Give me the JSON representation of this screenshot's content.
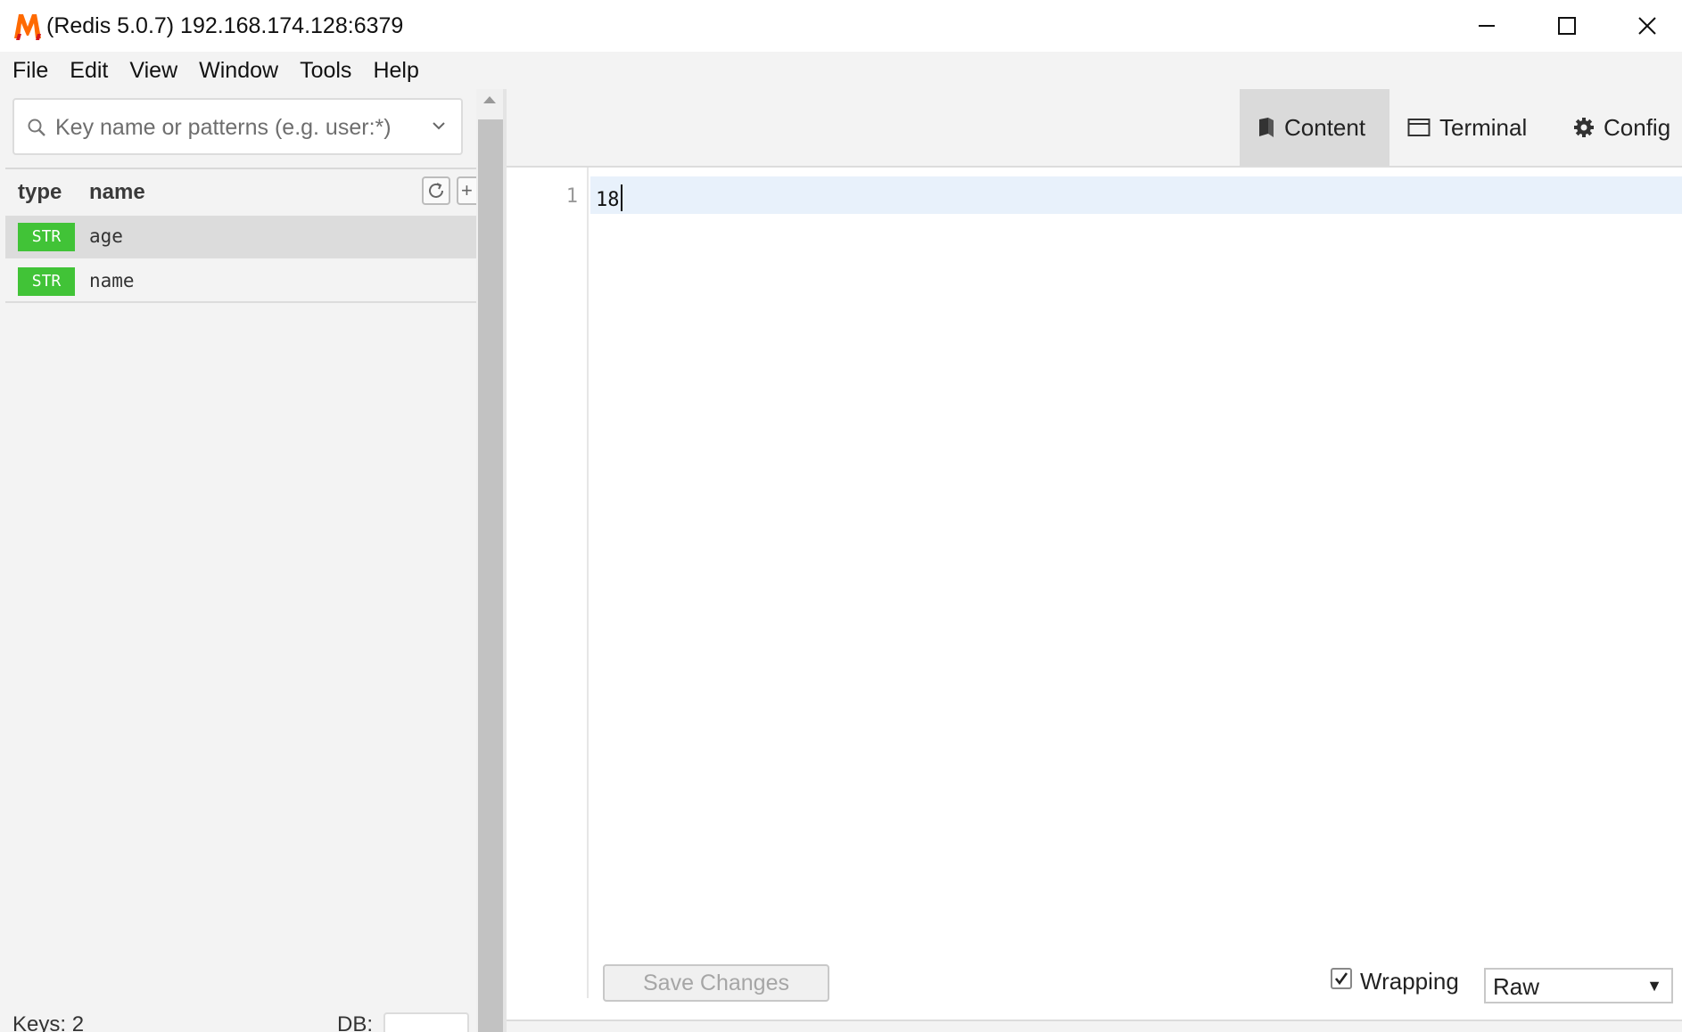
{
  "window": {
    "title": "(Redis 5.0.7) 192.168.174.128:6379",
    "logo_letter": "M",
    "controls": {
      "minimize": "minimize-icon",
      "maximize": "maximize-icon",
      "close": "close-icon"
    }
  },
  "menu": [
    "File",
    "Edit",
    "View",
    "Window",
    "Tools",
    "Help"
  ],
  "search": {
    "placeholder": "Key name or patterns (e.g. user:*)"
  },
  "key_list": {
    "header": {
      "type": "type",
      "name": "name",
      "add": "+"
    },
    "keys": [
      {
        "type": "STR",
        "name": "age",
        "selected": true
      },
      {
        "type": "STR",
        "name": "name",
        "selected": false
      }
    ],
    "footer": {
      "keys_label": "Keys: 2",
      "db_label": "DB:"
    }
  },
  "tabs": [
    {
      "label": "Content",
      "icon": "book-icon",
      "active": true
    },
    {
      "label": "Terminal",
      "icon": "terminal-window-icon",
      "active": false
    },
    {
      "label": "Config",
      "icon": "gear-icon",
      "active": false
    }
  ],
  "editor": {
    "lines": [
      {
        "number": "1",
        "text": "18"
      }
    ]
  },
  "controls": {
    "save_label": "Save Changes",
    "wrapping_label": "Wrapping",
    "wrapping_checked": true,
    "format_value": "Raw"
  },
  "colors": {
    "str_badge": "#41c337",
    "active_line": "#e8f1fb",
    "logo_orange": "#ff6a00",
    "logo_red": "#d4141c"
  }
}
